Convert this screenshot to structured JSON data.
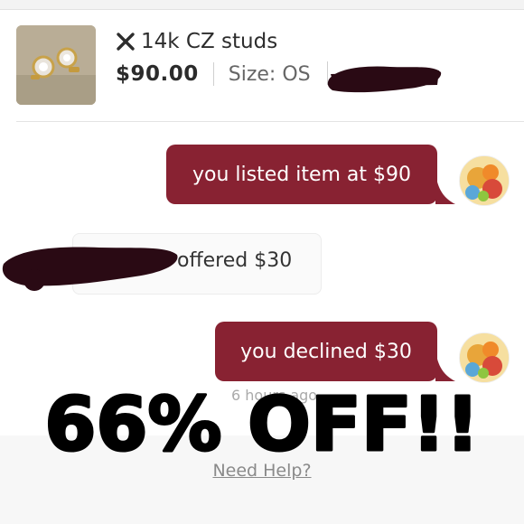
{
  "listing": {
    "title": "14k CZ studs",
    "price": "$90.00",
    "size": "Size: OS"
  },
  "chat": {
    "message_listed": "you listed item at $90",
    "offer_text": "offered $30",
    "message_declined": "you declined $30",
    "timestamp": "6 hours ago"
  },
  "overlay": {
    "promo_text": "66% OFF!!"
  },
  "footer": {
    "help_link": "Need Help?"
  },
  "colors": {
    "bubble": "#882232",
    "redaction": "#2a0a14"
  },
  "icons": [
    "close-icon",
    "earring-thumbnail",
    "avatar"
  ]
}
